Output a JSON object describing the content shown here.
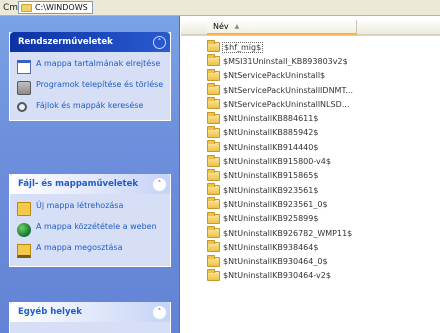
{
  "address": {
    "label": "Cm",
    "path": "C:\\WINDOWS"
  },
  "tasks_panel": {
    "title": "Rendszerműveletek",
    "items": [
      {
        "icon": "window-icon",
        "label": "A mappa tartalmának elrejtése"
      },
      {
        "icon": "programs-icon",
        "label": "Programok telepítése és törlése"
      },
      {
        "icon": "search-icon",
        "label": "Fájlok és mappák keresése"
      }
    ]
  },
  "file_panel": {
    "title": "Fájl- és mappaműveletek",
    "items": [
      {
        "icon": "new-folder-icon",
        "label": "Új mappa létrehozása"
      },
      {
        "icon": "globe-icon",
        "label": "A mappa közzététele a weben"
      },
      {
        "icon": "share-folder-icon",
        "label": "A mappa megosztása"
      }
    ]
  },
  "other_panel": {
    "title": "Egyéb helyek"
  },
  "list": {
    "column_name": "Név",
    "files": [
      "$hf_mig$",
      "$MSI31Uninstall_KB893803v2$",
      "$NtServicePackUninstall$",
      "$NtServicePackUninstallIDNMT...",
      "$NtServicePackUninstallNLSD...",
      "$NtUninstallKB884611$",
      "$NtUninstallKB885942$",
      "$NtUninstallKB914440$",
      "$NtUninstallKB915800-v4$",
      "$NtUninstallKB915865$",
      "$NtUninstallKB923561$",
      "$NtUninstallKB923561_0$",
      "$NtUninstallKB925899$",
      "$NtUninstallKB926782_WMP11$",
      "$NtUninstallKB938464$",
      "$NtUninstallKB930464_0$",
      "$NtUninstallKB930464-v2$"
    ]
  }
}
